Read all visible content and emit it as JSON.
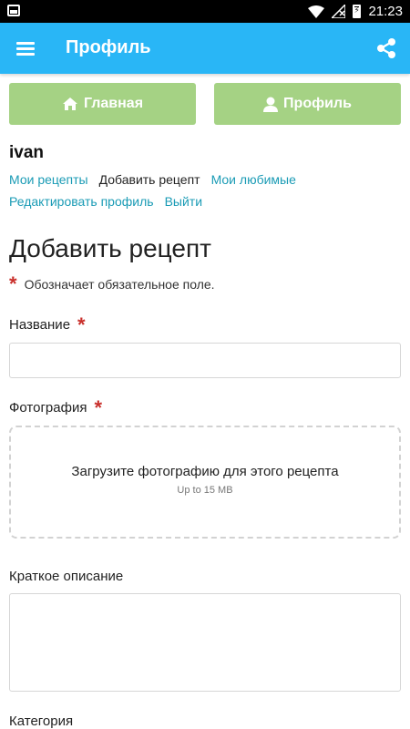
{
  "status_bar": {
    "time": "21:23"
  },
  "app_bar": {
    "title": "Профиль"
  },
  "nav_buttons": {
    "home_label": "Главная",
    "profile_label": "Профиль"
  },
  "user": {
    "name": "ivan"
  },
  "links": {
    "my_recipes": "Мои рецепты",
    "add_recipe": "Добавить рецепт",
    "favorites": "Мои любимые",
    "edit_profile": "Редактировать профиль",
    "logout": "Выйти"
  },
  "form": {
    "title": "Добавить рецепт",
    "required_star": "*",
    "required_note": "Обозначает обязательное поле.",
    "name_label": "Название",
    "name_value": "",
    "photo_label": "Фотография",
    "upload_text": "Загрузите фотографию для этого рецепта",
    "upload_limit": "Up to 15 MB",
    "summary_label": "Краткое описание",
    "summary_value": "",
    "category_label": "Категория"
  },
  "colors": {
    "app_bar": "#29b6f6",
    "nav_button": "#a5d284",
    "link": "#1a9bb5",
    "required": "#c9302c"
  },
  "icons": [
    "image-icon",
    "wifi-icon",
    "signal-icon",
    "battery-icon",
    "menu-icon",
    "share-icon",
    "home-icon",
    "user-icon",
    "asterisk-icon"
  ]
}
